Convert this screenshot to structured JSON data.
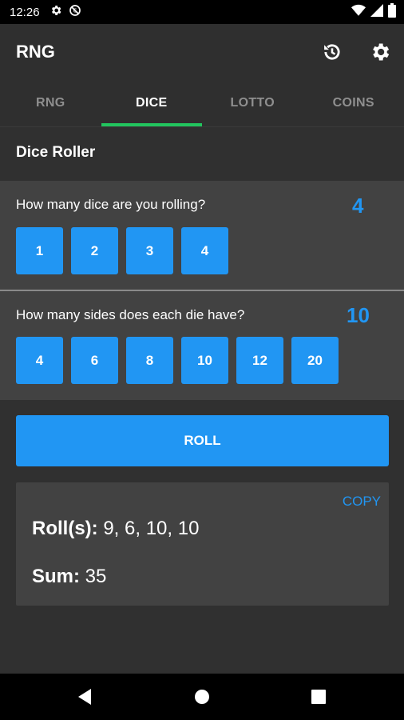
{
  "status": {
    "time": "12:26"
  },
  "app": {
    "title": "RNG"
  },
  "tabs": [
    {
      "label": "RNG",
      "active": false
    },
    {
      "label": "DICE",
      "active": true
    },
    {
      "label": "LOTTO",
      "active": false
    },
    {
      "label": "COINS",
      "active": false
    }
  ],
  "section_title": "Dice Roller",
  "dice_count": {
    "question": "How many dice are you rolling?",
    "selected": "4",
    "options": [
      "1",
      "2",
      "3",
      "4"
    ]
  },
  "dice_sides": {
    "question": "How many sides does each die have?",
    "selected": "10",
    "options": [
      "4",
      "6",
      "8",
      "10",
      "12",
      "20"
    ]
  },
  "roll_label": "ROLL",
  "result": {
    "copy_label": "COPY",
    "rolls_label": "Roll(s):",
    "rolls_value": "9, 6, 10, 10",
    "sum_label": "Sum:",
    "sum_value": "35"
  },
  "colors": {
    "accent": "#2196f3",
    "tab_indicator": "#22c55e",
    "background": "#303030",
    "card": "#424242"
  },
  "icons": [
    "settings-status-icon",
    "dnd-status-icon",
    "wifi-icon",
    "signal-icon",
    "battery-icon",
    "history-icon",
    "settings-icon",
    "back-nav-icon",
    "home-nav-icon",
    "recents-nav-icon"
  ]
}
